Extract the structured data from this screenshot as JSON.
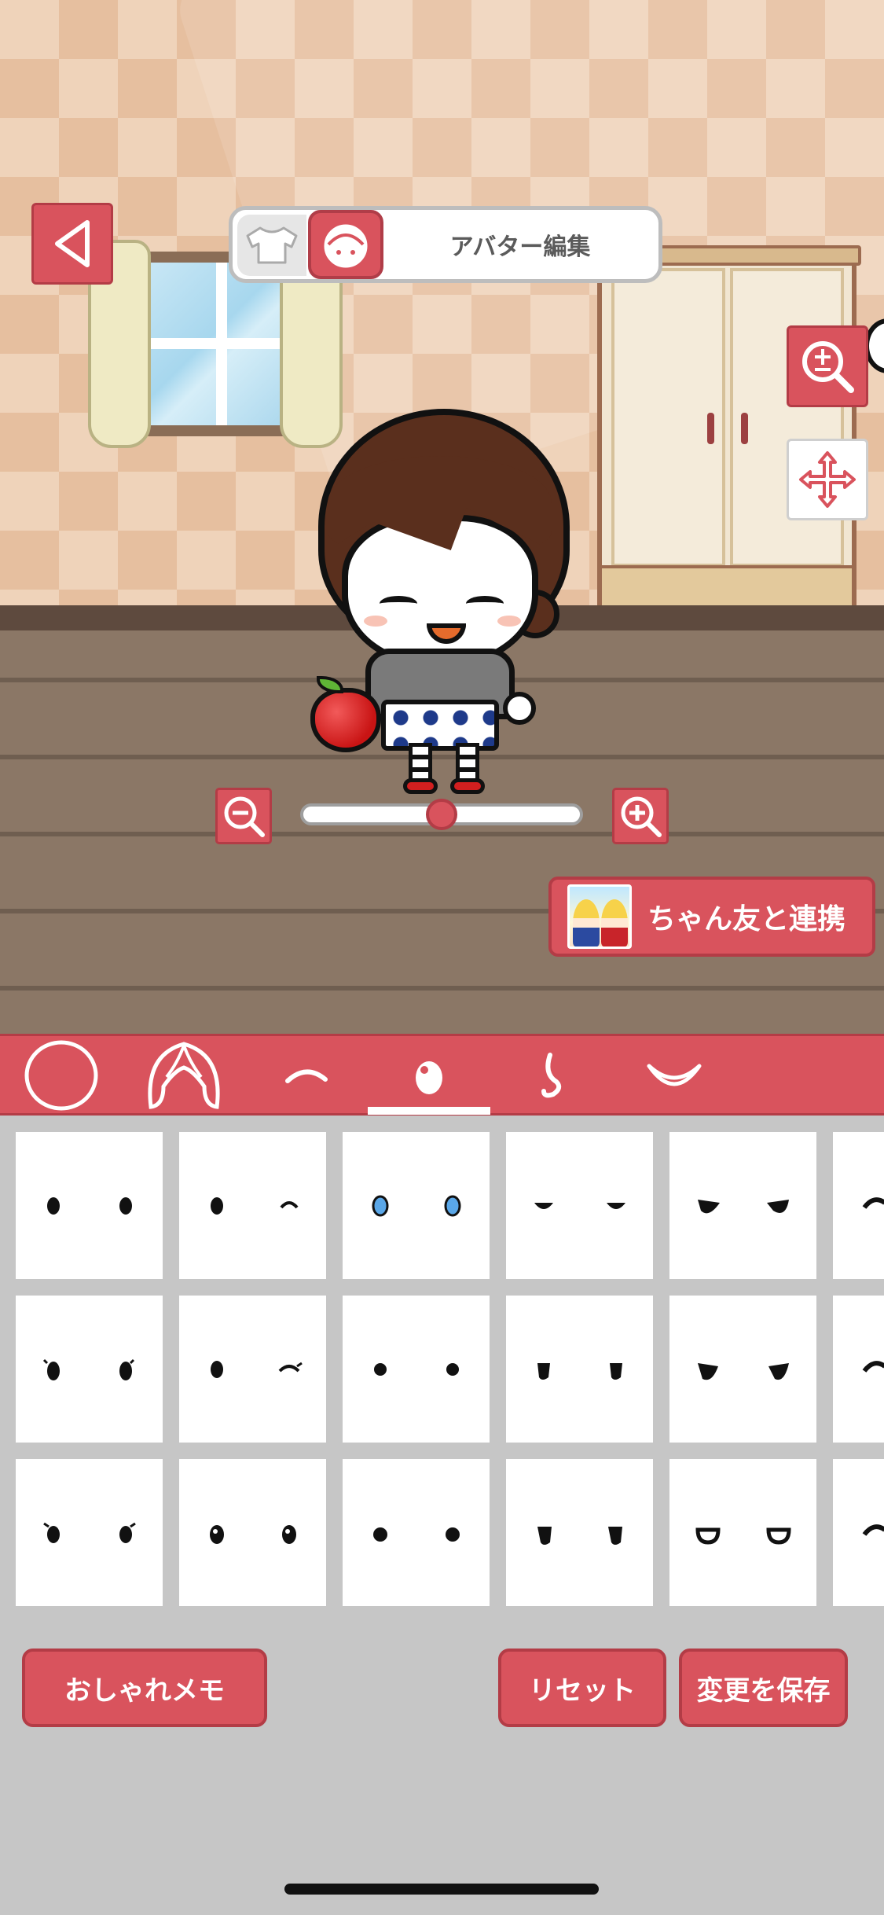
{
  "header": {
    "title": "アバター編集",
    "back_icon": "back-arrow-icon",
    "segments": [
      {
        "icon": "clothes-icon",
        "selected": false
      },
      {
        "icon": "avatar-face-icon",
        "selected": true
      }
    ]
  },
  "side_tools": [
    {
      "icon": "zoom-toggle-icon"
    },
    {
      "icon": "move-arrows-icon"
    }
  ],
  "zoom_slider": {
    "value": 0.5,
    "minus_icon": "zoom-out-icon",
    "plus_icon": "zoom-in-icon"
  },
  "collab_button": {
    "label": "ちゃん友と連携"
  },
  "part_tabs": [
    {
      "icon": "face-outline-icon",
      "selected": false
    },
    {
      "icon": "hair-icon",
      "selected": false
    },
    {
      "icon": "eyebrow-icon",
      "selected": false
    },
    {
      "icon": "eye-icon",
      "selected": true
    },
    {
      "icon": "nose-icon",
      "selected": false
    },
    {
      "icon": "mouth-icon",
      "selected": false
    }
  ],
  "eye_options": [
    {
      "style": "dots"
    },
    {
      "style": "dot-wink"
    },
    {
      "style": "blue-sparkle"
    },
    {
      "style": "half-moon"
    },
    {
      "style": "angry"
    },
    {
      "style": "partial"
    },
    {
      "style": "oval-lash"
    },
    {
      "style": "dot-wink-lash"
    },
    {
      "style": "small-dots"
    },
    {
      "style": "tall-oval"
    },
    {
      "style": "angry-oval"
    },
    {
      "style": "partial"
    },
    {
      "style": "lash-dot"
    },
    {
      "style": "starry"
    },
    {
      "style": "side-dot"
    },
    {
      "style": "tall-half"
    },
    {
      "style": "smile-lid"
    },
    {
      "style": "partial"
    }
  ],
  "buttons": {
    "memo": "おしゃれメモ",
    "reset": "リセット",
    "save": "変更を保存"
  },
  "colors": {
    "accent": "#d9535d",
    "accent_dark": "#b33c46",
    "panel_bg": "#c6c6c6"
  }
}
